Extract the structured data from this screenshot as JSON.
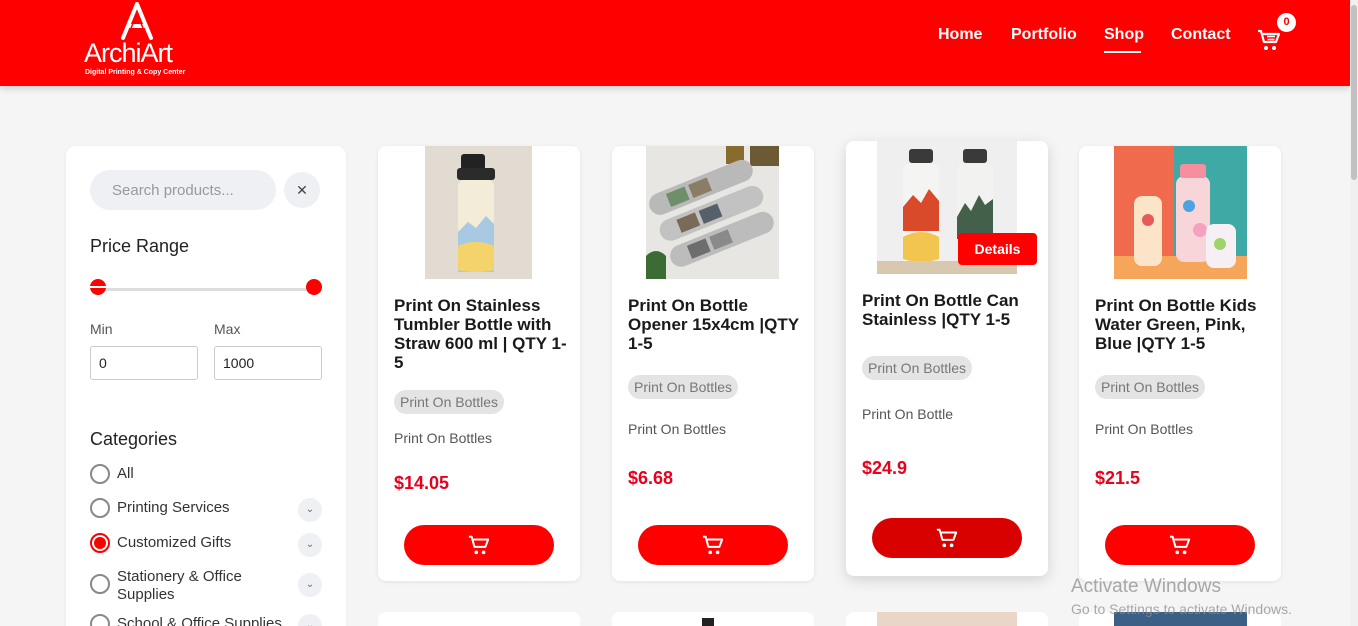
{
  "brand": {
    "name": "ArchiArt",
    "tagline": "Digital Printing & Copy Center"
  },
  "nav": {
    "items": [
      "Home",
      "Portfolio",
      "Shop",
      "Contact"
    ],
    "active": "Shop",
    "cart_count": "0"
  },
  "colors": {
    "primary": "#fe0000",
    "price": "#e8001c",
    "background": "#f5f5f6"
  },
  "sidebar": {
    "search_placeholder": "Search products...",
    "clear_icon": "✕",
    "price_range_heading": "Price Range",
    "min_label": "Min",
    "max_label": "Max",
    "min_value": "0",
    "max_value": "1000",
    "categories_heading": "Categories",
    "categories": [
      {
        "label": "All",
        "checked": false,
        "expandable": false
      },
      {
        "label": "Printing Services",
        "checked": false,
        "expandable": true
      },
      {
        "label": "Customized Gifts",
        "checked": true,
        "expandable": true
      },
      {
        "label": "Stationery & Office Supplies",
        "checked": false,
        "expandable": true
      },
      {
        "label": "School & Office Supplies",
        "checked": false,
        "expandable": true
      }
    ]
  },
  "products": [
    {
      "title": "Print On Stainless Tumbler Bottle with Straw 600 ml | QTY 1-5",
      "badge": "Print On Bottles",
      "category": "Print On Bottles",
      "price": "$14.05",
      "image_icon": "tumbler-bottle-image"
    },
    {
      "title": "Print On Bottle Opener 15x4cm |QTY 1-5",
      "badge": "Print On Bottles",
      "category": "Print On Bottles",
      "price": "$6.68",
      "image_icon": "bottle-opener-image"
    },
    {
      "title": "Print On Bottle Can Stainless |QTY 1-5",
      "badge": "Print On Bottles",
      "category": "Print On Bottle",
      "price": "$24.9",
      "details_label": "Details",
      "image_icon": "stainless-bottles-image"
    },
    {
      "title": "Print On Bottle Kids Water Green, Pink, Blue |QTY 1-5",
      "badge": "Print On Bottles",
      "category": "Print On Bottles",
      "price": "$21.5",
      "image_icon": "kids-bottles-image"
    }
  ],
  "watermark": {
    "line1": "Activate Windows",
    "line2": "Go to Settings to activate Windows."
  }
}
